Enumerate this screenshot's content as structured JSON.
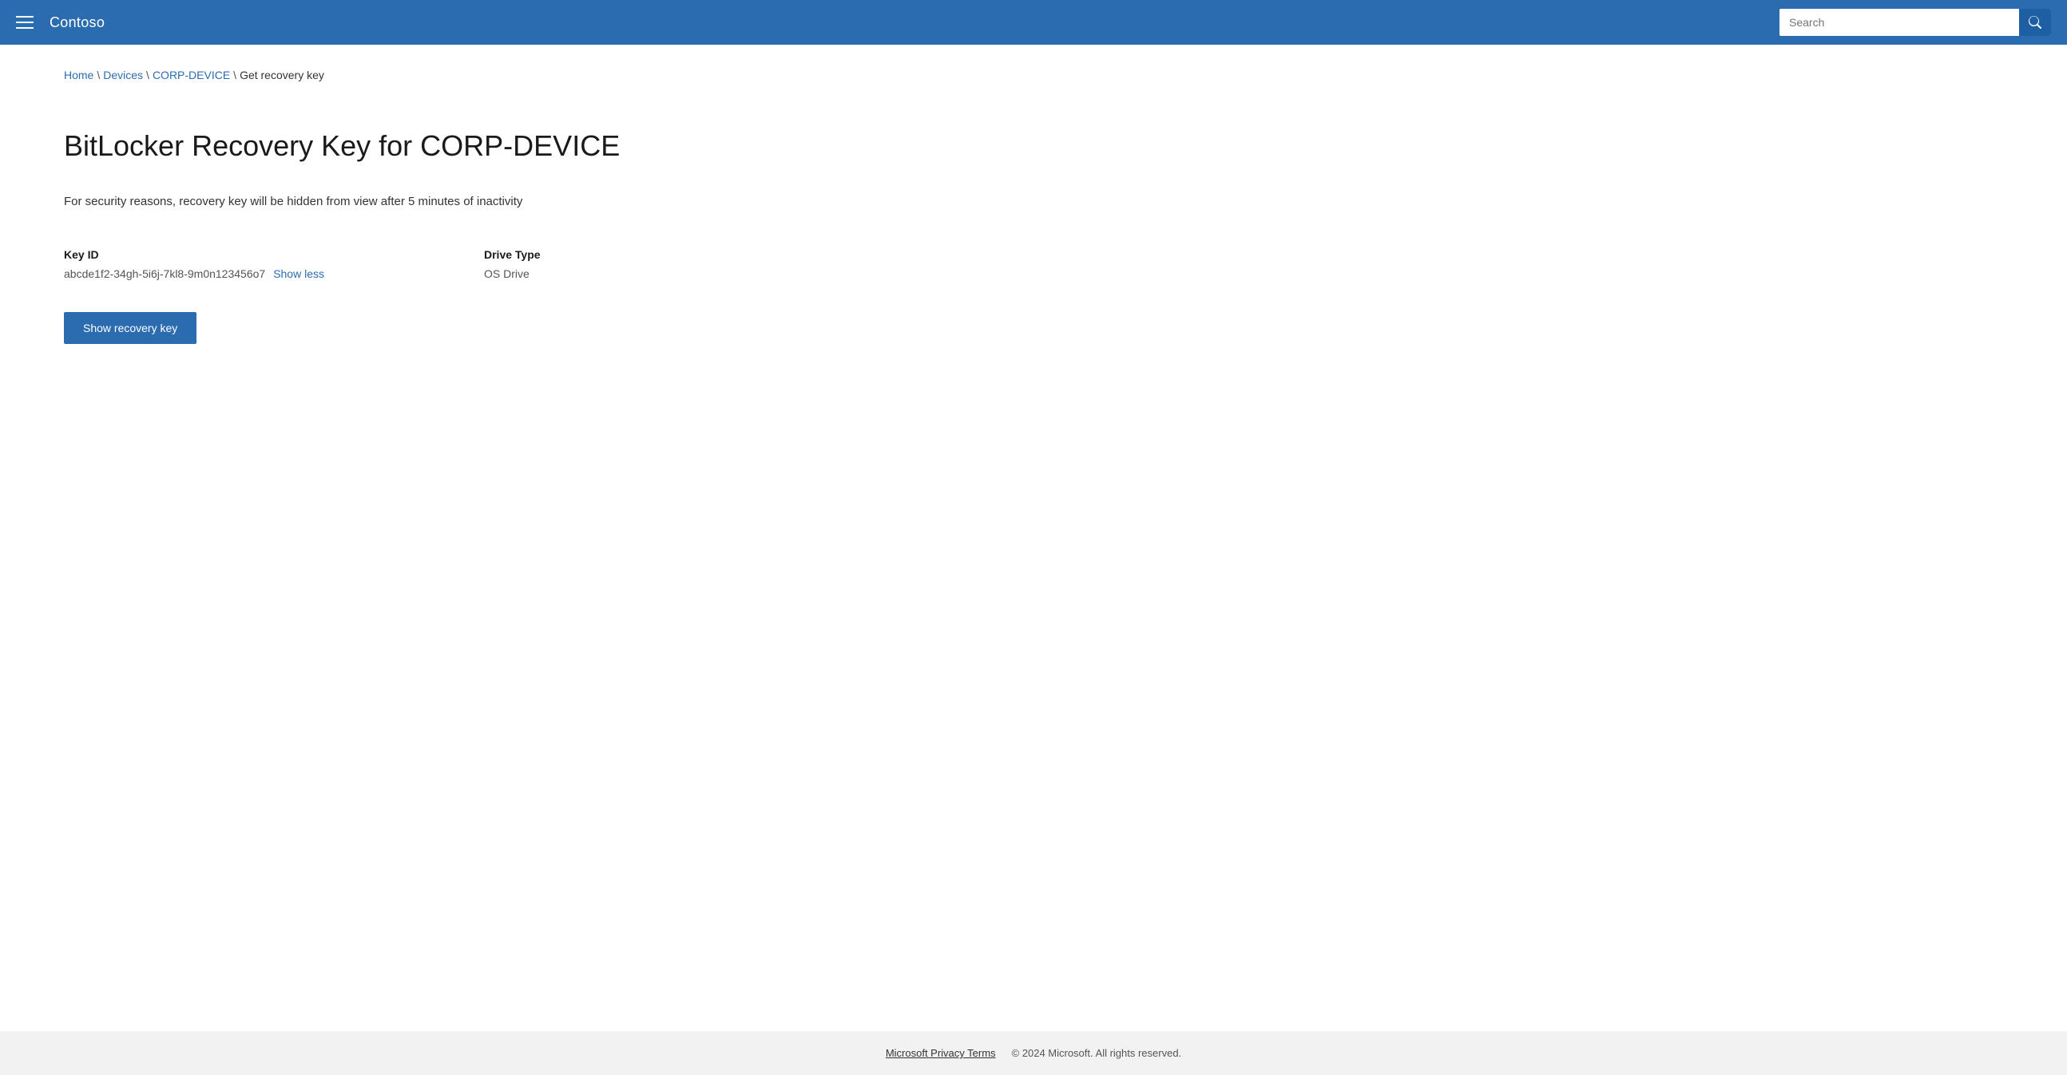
{
  "header": {
    "brand": "Contoso",
    "search_placeholder": "Search"
  },
  "breadcrumb": {
    "home": "Home",
    "devices": "Devices",
    "device_name": "CORP-DEVICE",
    "current": "Get recovery key"
  },
  "main": {
    "page_title": "BitLocker Recovery Key for CORP-DEVICE",
    "description": "For security reasons, recovery key will be hidden from view after 5 minutes of inactivity",
    "key_id_label": "Key ID",
    "key_id_value": "abcde1f2-34gh-5i6j-7kl8-9m0n123456o7",
    "show_less_label": "Show less",
    "drive_type_label": "Drive Type",
    "drive_type_value": "OS Drive",
    "show_recovery_button": "Show recovery key"
  },
  "footer": {
    "privacy_link": "Microsoft Privacy Terms",
    "copyright": "© 2024 Microsoft. All rights reserved."
  }
}
